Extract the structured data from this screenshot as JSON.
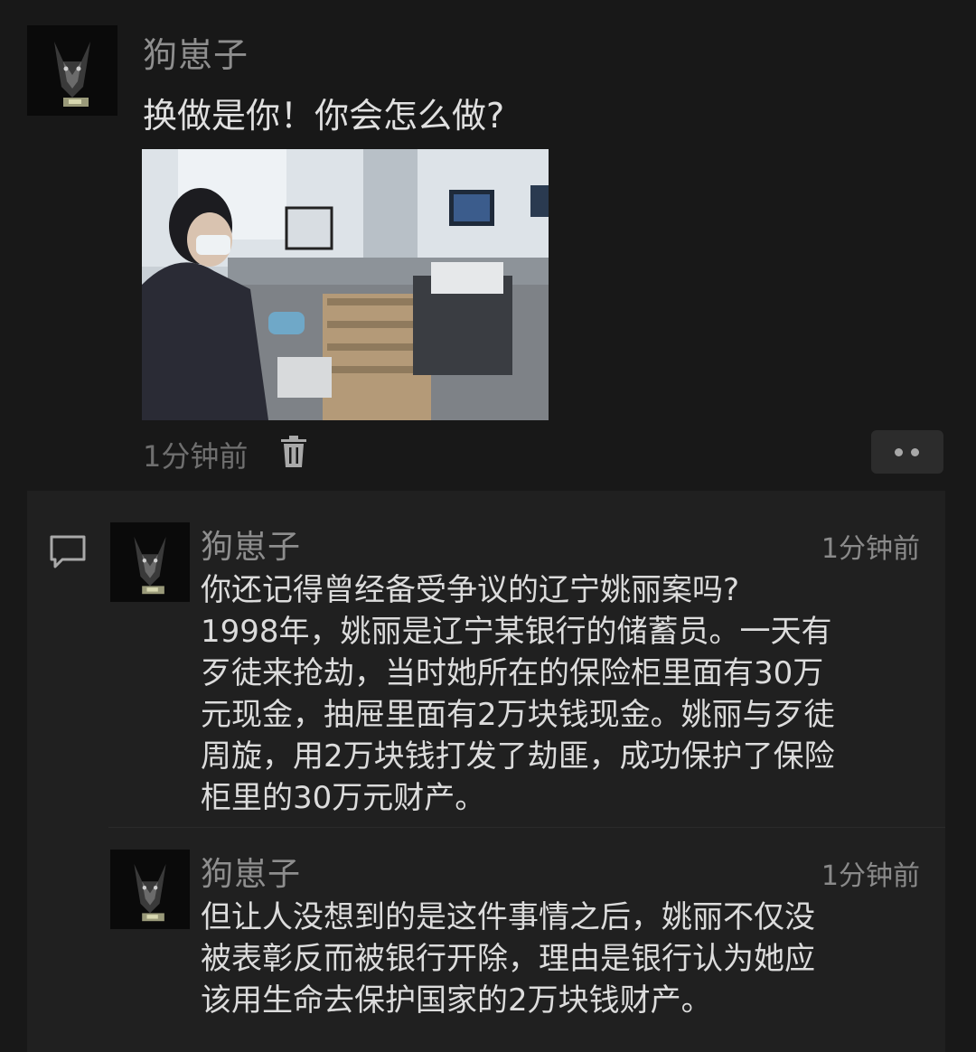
{
  "post": {
    "author": "狗崽子",
    "text": "换做是你！你会怎么做?",
    "time": "1分钟前",
    "photo_icon": "bank-teller-photo",
    "delete_icon": "trash-icon",
    "more_icon": "more-dots-icon"
  },
  "comments": [
    {
      "author": "狗崽子",
      "time": "1分钟前",
      "lines": [
        "你还记得曾经备受争议的辽宁姚丽案吗?",
        "1998年，姚丽是辽宁某银行的储蓄员。一天有",
        "歹徒来抢劫，当时她所在的保险柜里面有30万",
        "元现金，抽屉里面有2万块钱现金。姚丽与歹徒",
        "周旋，用2万块钱打发了劫匪，成功保护了保险",
        "柜里的30万元财产。"
      ]
    },
    {
      "author": "狗崽子",
      "time": "1分钟前",
      "lines": [
        "但让人没想到的是这件事情之后，姚丽不仅没",
        "被表彰反而被银行开除，理由是银行认为她应",
        "该用生命去保护国家的2万块钱财产。"
      ]
    }
  ],
  "colors": {
    "background": "#181818",
    "comments_background": "#202020",
    "name": "#8e8e8e",
    "text": "#dcdcdc"
  }
}
